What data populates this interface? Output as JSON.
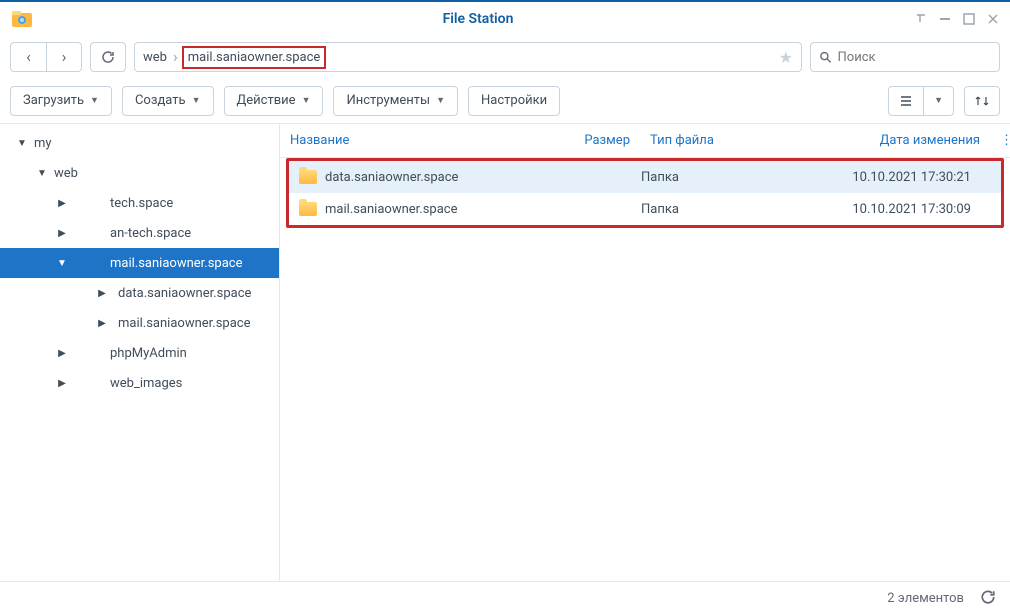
{
  "window": {
    "title": "File Station"
  },
  "nav": {
    "path": [
      "web",
      "mail.saniaowner.space"
    ],
    "search_placeholder": "Поиск"
  },
  "toolbar": {
    "upload": "Загрузить",
    "create": "Создать",
    "action": "Действие",
    "tools": "Инструменты",
    "settings": "Настройки"
  },
  "tree": [
    {
      "label": "my",
      "depth": 0,
      "expanded": true
    },
    {
      "label": "web",
      "depth": 1,
      "expanded": true
    },
    {
      "label": "tech.space",
      "depth": 2,
      "collapsed": true
    },
    {
      "label": "an-tech.space",
      "depth": 2,
      "collapsed": true
    },
    {
      "label": "mail.saniaowner.space",
      "depth": 2,
      "selected": true,
      "expanded": true
    },
    {
      "label": "data.saniaowner.space",
      "depth": 3,
      "collapsed": true
    },
    {
      "label": "mail.saniaowner.space",
      "depth": 3,
      "collapsed": true
    },
    {
      "label": "phpMyAdmin",
      "depth": 2,
      "collapsed": true
    },
    {
      "label": "web_images",
      "depth": 2,
      "collapsed": true
    }
  ],
  "columns": {
    "name": "Название",
    "size": "Размер",
    "type": "Тип файла",
    "date": "Дата изменения"
  },
  "rows": [
    {
      "name": "data.saniaowner.space",
      "size": "",
      "type": "Папка",
      "date": "10.10.2021 17:30:21",
      "selected": true
    },
    {
      "name": "mail.saniaowner.space",
      "size": "",
      "type": "Папка",
      "date": "10.10.2021 17:30:09"
    }
  ],
  "status": {
    "count": "2 элементов"
  }
}
